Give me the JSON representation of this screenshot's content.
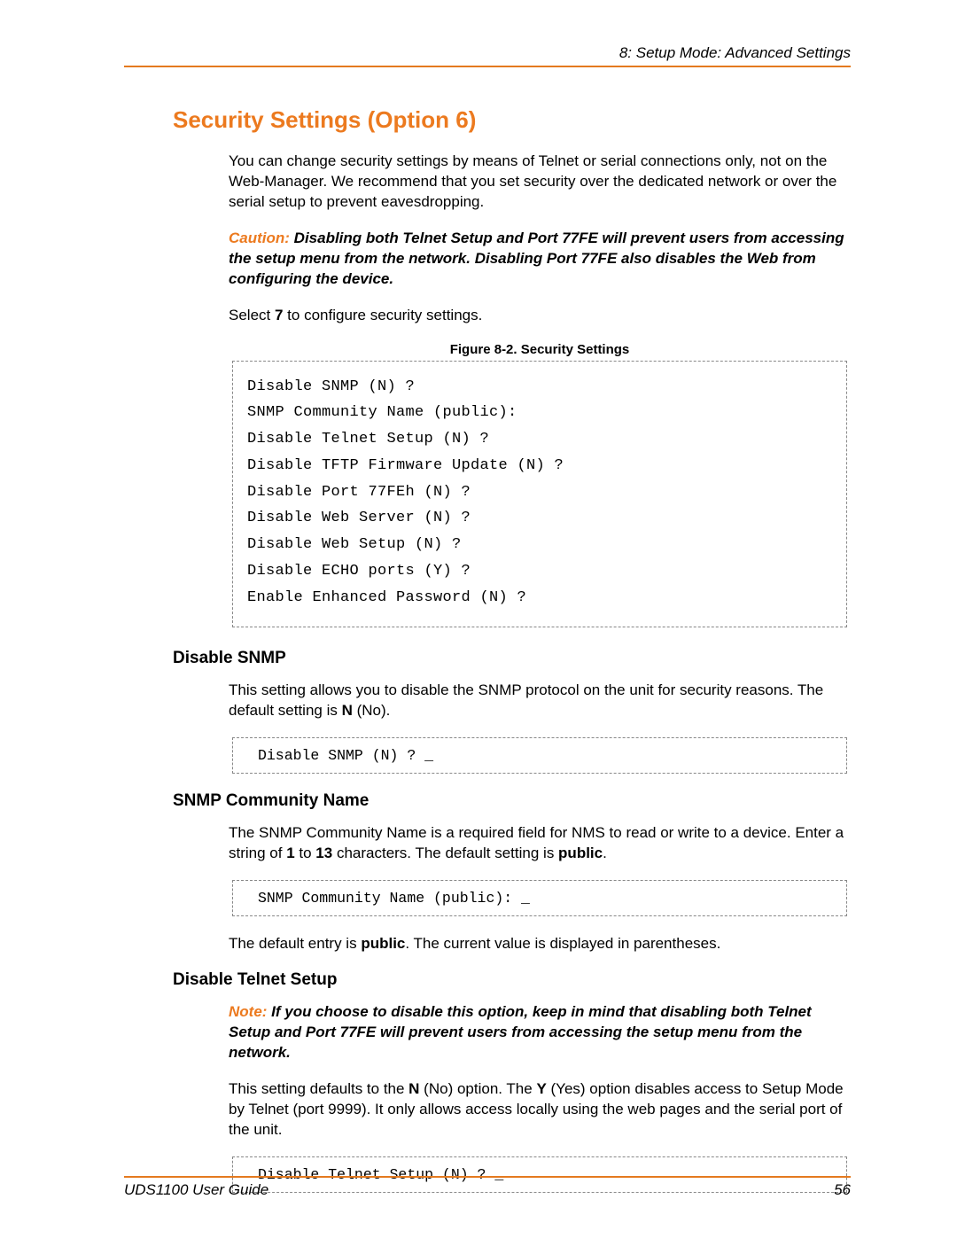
{
  "header": {
    "chapter": "8: Setup Mode: Advanced Settings"
  },
  "title": "Security Settings (Option 6)",
  "intro": "You can change security settings by means of Telnet or serial connections only, not on the Web-Manager. We recommend that you set security over the dedicated network or over the serial setup to prevent eavesdropping.",
  "caution": {
    "label": "Caution:",
    "text": " Disabling both Telnet Setup and Port 77FE will prevent users from accessing the setup menu from the network. Disabling Port 77FE also disables the Web from configuring the device."
  },
  "select_line": {
    "pre": "Select ",
    "bold": "7",
    "post": " to configure security settings."
  },
  "figure_caption": "Figure 8-2. Security Settings",
  "terminal": {
    "lines": [
      "Disable SNMP (N) ?",
      "SNMP Community Name (public):",
      "Disable Telnet Setup (N) ?",
      "Disable TFTP Firmware Update (N) ?",
      "Disable Port 77FEh (N) ?",
      "Disable Web Server (N) ?",
      "Disable Web Setup (N) ?",
      "Disable ECHO ports (Y) ?",
      "Enable Enhanced Password (N) ?"
    ]
  },
  "sections": {
    "disable_snmp": {
      "heading": "Disable SNMP",
      "p1_pre": "This setting allows you to disable the SNMP protocol on the unit for security reasons. The default setting is ",
      "p1_b": "N",
      "p1_post": " (No).",
      "prompt": "Disable SNMP (N) ? _"
    },
    "snmp_name": {
      "heading": "SNMP Community Name",
      "p1_pre": "The SNMP Community Name is a required field for NMS to read or write to a device. Enter a string of ",
      "p1_b1": "1",
      "p1_mid": " to ",
      "p1_b2": "13",
      "p1_post1": " characters. The default setting is ",
      "p1_b3": "public",
      "p1_post2": ".",
      "prompt": "SNMP Community Name (public): _",
      "p2_pre": "The default entry is ",
      "p2_b": "public",
      "p2_post": ". The current value is displayed in parentheses."
    },
    "disable_telnet": {
      "heading": "Disable Telnet Setup",
      "note_label": "Note:",
      "note_text": " If you choose to disable this option, keep in mind that disabling both Telnet Setup and Port 77FE will prevent users from accessing the setup menu from the network.",
      "p1_pre": "This setting defaults to the ",
      "p1_b1": "N",
      "p1_mid": " (No) option. The ",
      "p1_b2": "Y",
      "p1_post": " (Yes) option disables access to Setup Mode by Telnet (port 9999). It only allows access locally using the web pages and the serial port of the unit.",
      "prompt": "Disable Telnet Setup (N) ? _"
    }
  },
  "footer": {
    "guide": "UDS1100 User Guide",
    "page": "56"
  }
}
